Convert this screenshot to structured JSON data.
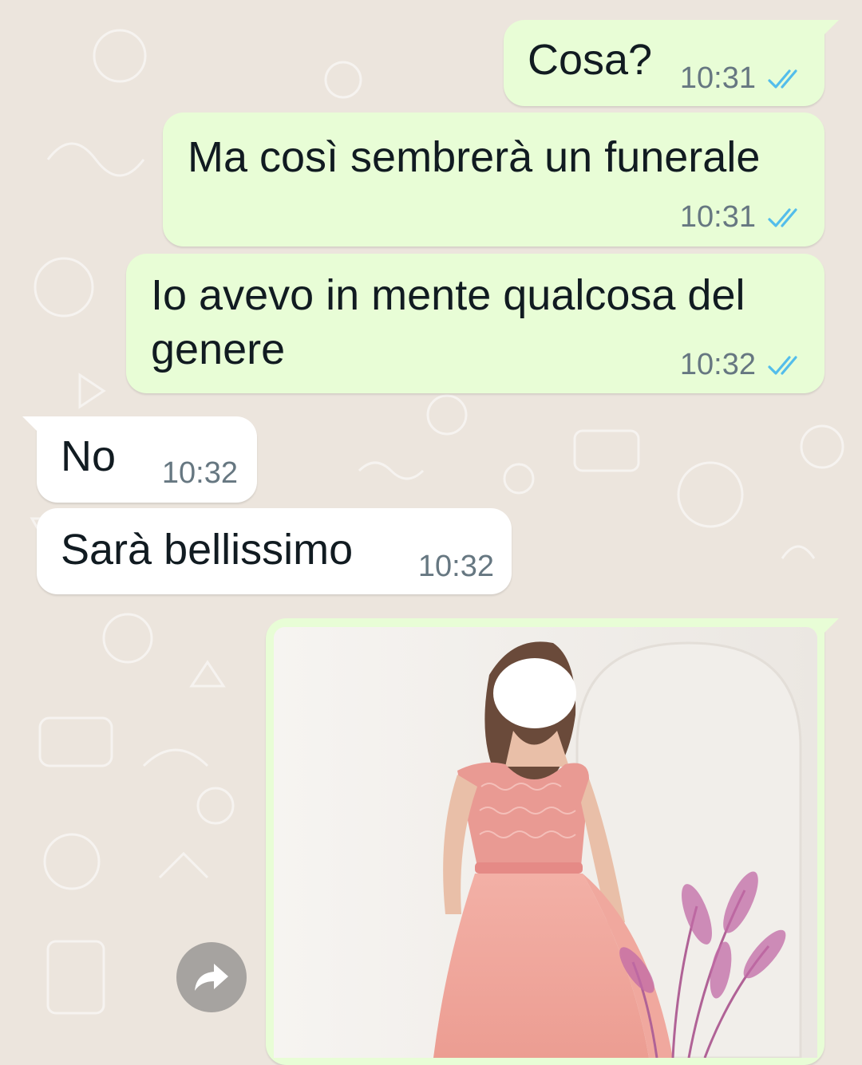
{
  "chat": {
    "messages": [
      {
        "direction": "outgoing",
        "text": "Cosa?",
        "time": "10:31",
        "status_icon": "double-check-read-icon",
        "status_color": "#53bdeb"
      },
      {
        "direction": "outgoing",
        "text": "Ma così sembrerà un funerale",
        "time": "10:31",
        "status_icon": "double-check-read-icon",
        "status_color": "#53bdeb"
      },
      {
        "direction": "outgoing",
        "lines": [
          "Io avevo in mente qualcosa del",
          "genere"
        ],
        "time": "10:32",
        "status_icon": "double-check-read-icon",
        "status_color": "#53bdeb"
      },
      {
        "direction": "incoming",
        "text": "No",
        "time": "10:32"
      },
      {
        "direction": "incoming",
        "text": "Sarà bellissimo",
        "time": "10:32"
      },
      {
        "direction": "outgoing",
        "type": "image",
        "content": "pink lace evening dress photo"
      }
    ],
    "forward_icon": "forward-share-icon"
  },
  "colors": {
    "wallpaper": "#ece5dd",
    "outgoing_bubble": "#e8fdd6",
    "incoming_bubble": "#ffffff",
    "read_ticks": "#53bdeb",
    "timestamp": "#667781"
  }
}
